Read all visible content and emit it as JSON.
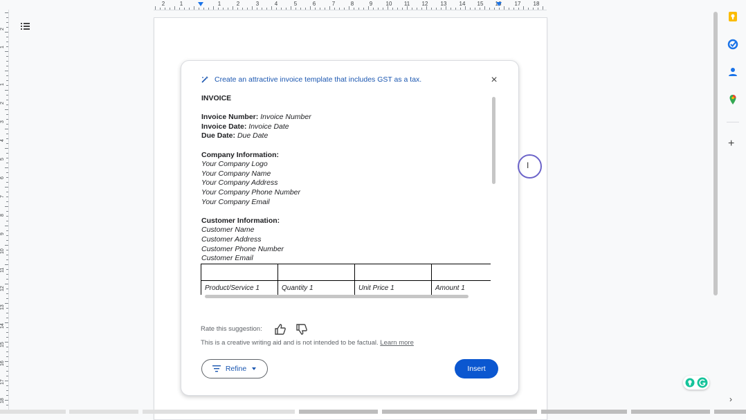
{
  "ruler": {
    "top_numbers": [
      "2",
      "1",
      "1",
      "2",
      "3",
      "4",
      "5",
      "6",
      "7",
      "8",
      "9",
      "10",
      "11",
      "12",
      "13",
      "14",
      "15",
      "16",
      "17",
      "18"
    ],
    "left_numbers": [
      "2",
      "1",
      "1",
      "2",
      "3",
      "4",
      "5",
      "6",
      "7",
      "8",
      "9",
      "10",
      "11",
      "12",
      "13",
      "14",
      "15",
      "16",
      "17",
      "18"
    ]
  },
  "dialog": {
    "prompt": "Create an attractive invoice template that includes GST as a tax.",
    "close_icon": "close-icon",
    "content": {
      "title": "INVOICE",
      "invoice_number_label": "Invoice Number:",
      "invoice_number_value": "Invoice Number",
      "invoice_date_label": "Invoice Date:",
      "invoice_date_value": "Invoice Date",
      "due_date_label": "Due Date:",
      "due_date_value": "Due Date",
      "company_heading": "Company Information:",
      "company_lines": [
        "Your Company Logo",
        "Your Company Name",
        "Your Company Address",
        "Your Company Phone Number",
        "Your Company Email"
      ],
      "customer_heading": "Customer Information:",
      "customer_lines": [
        "Customer Name",
        "Customer Address",
        "Customer Phone Number",
        "Customer Email"
      ]
    },
    "table_row": [
      "Product/Service 1",
      "Quantity 1",
      "Unit Price 1",
      "Amount 1"
    ],
    "rate_label": "Rate this suggestion:",
    "disclaimer": "This is a creative writing aid and is not intended to be factual.",
    "learn_more": "Learn more",
    "refine_label": "Refine",
    "insert_label": "Insert"
  },
  "colors": {
    "accent": "#0b57d0",
    "prompt_text": "#1a56b0",
    "cursor_ring": "#6b63c9"
  },
  "sidebar": {
    "icons": [
      "keep-icon",
      "tasks-icon",
      "contacts-icon",
      "maps-icon"
    ],
    "add_icon": "plus-icon",
    "expand_icon": "chevron-right-icon"
  }
}
